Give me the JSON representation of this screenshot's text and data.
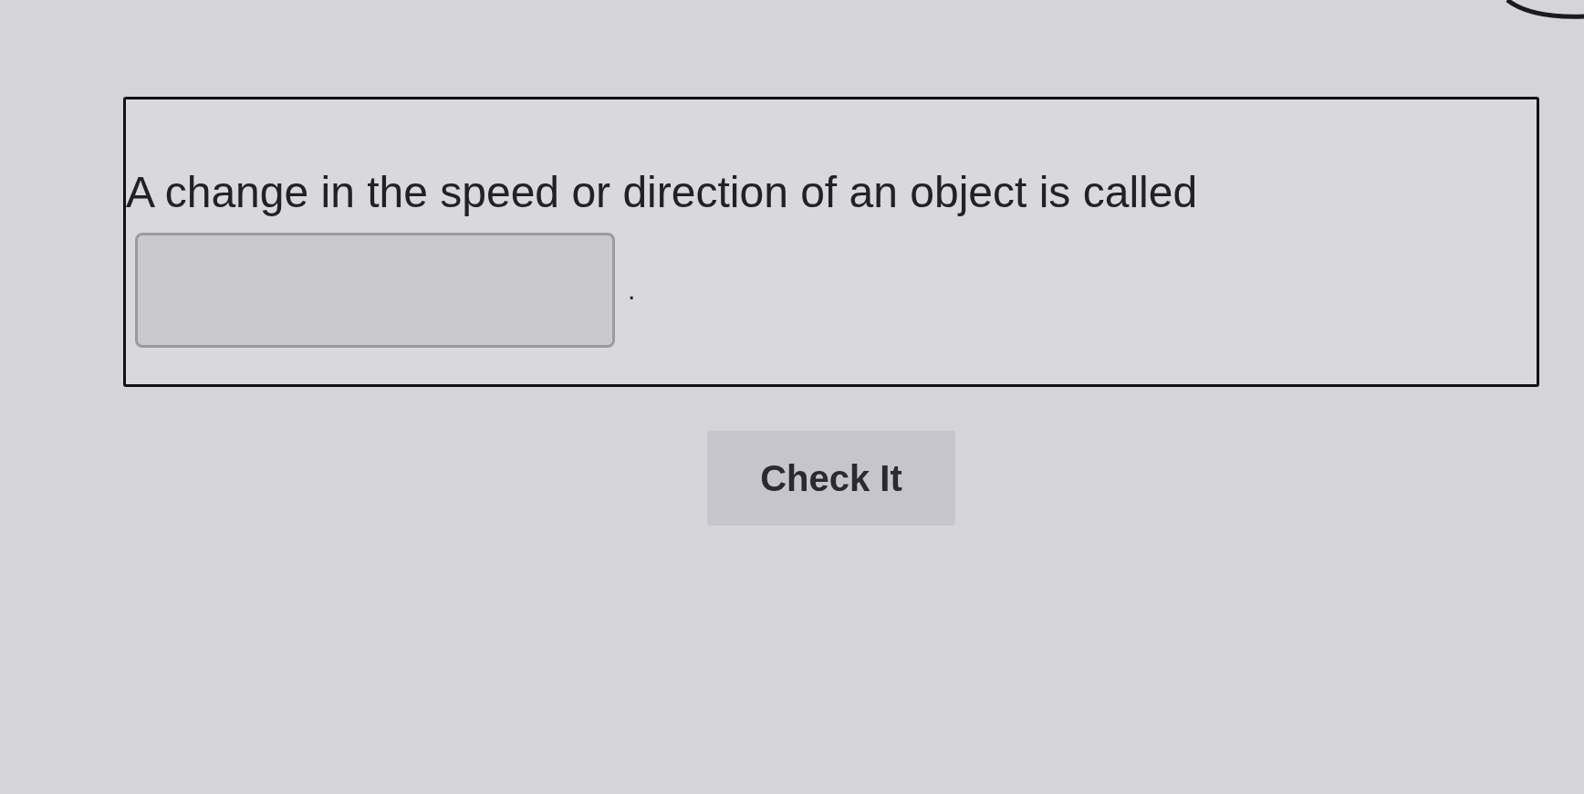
{
  "question": {
    "prompt": "A change in the speed or direction of an object is called",
    "after_blank": "."
  },
  "buttons": [
    {
      "label": "Check It"
    }
  ]
}
